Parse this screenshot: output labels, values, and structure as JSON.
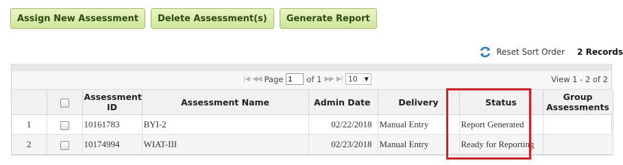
{
  "toolbar": {
    "assign_label": "Assign New Assessment",
    "delete_label": "Delete Assessment(s)",
    "report_label": "Generate Report"
  },
  "sortbar": {
    "reset_label": "Reset Sort Order",
    "records_label": "2 Records"
  },
  "pager": {
    "page_label": "Page",
    "page_value": "1",
    "of_label": "of 1",
    "page_size": "10",
    "view_info": "View 1 - 2 of 2"
  },
  "columns": {
    "assessment_id": "Assessment ID",
    "assessment_name": "Assessment Name",
    "admin_date": "Admin Date",
    "delivery": "Delivery",
    "status": "Status",
    "group_assessments": "Group Assessments"
  },
  "rows": [
    {
      "num": "1",
      "assessment_id": "10161783",
      "assessment_name": "BYI-2",
      "admin_date": "02/22/2018",
      "delivery": "Manual Entry",
      "status": "Report Generated",
      "group_assessments": ""
    },
    {
      "num": "2",
      "assessment_id": "10174994",
      "assessment_name": "WIAT-III",
      "admin_date": "02/23/2018",
      "delivery": "Manual Entry",
      "status": "Ready for Reporting",
      "group_assessments": ""
    }
  ],
  "colors": {
    "button_bg": "#d8ecab",
    "button_text": "#2d4a15",
    "highlight": "#e8141b",
    "refresh_icon": "#2b7bc0"
  },
  "icons": {
    "reset_sort": "refresh-icon",
    "first_page": "first-page-icon",
    "prev_page": "prev-page-icon",
    "next_page": "next-page-icon",
    "last_page": "last-page-icon"
  }
}
